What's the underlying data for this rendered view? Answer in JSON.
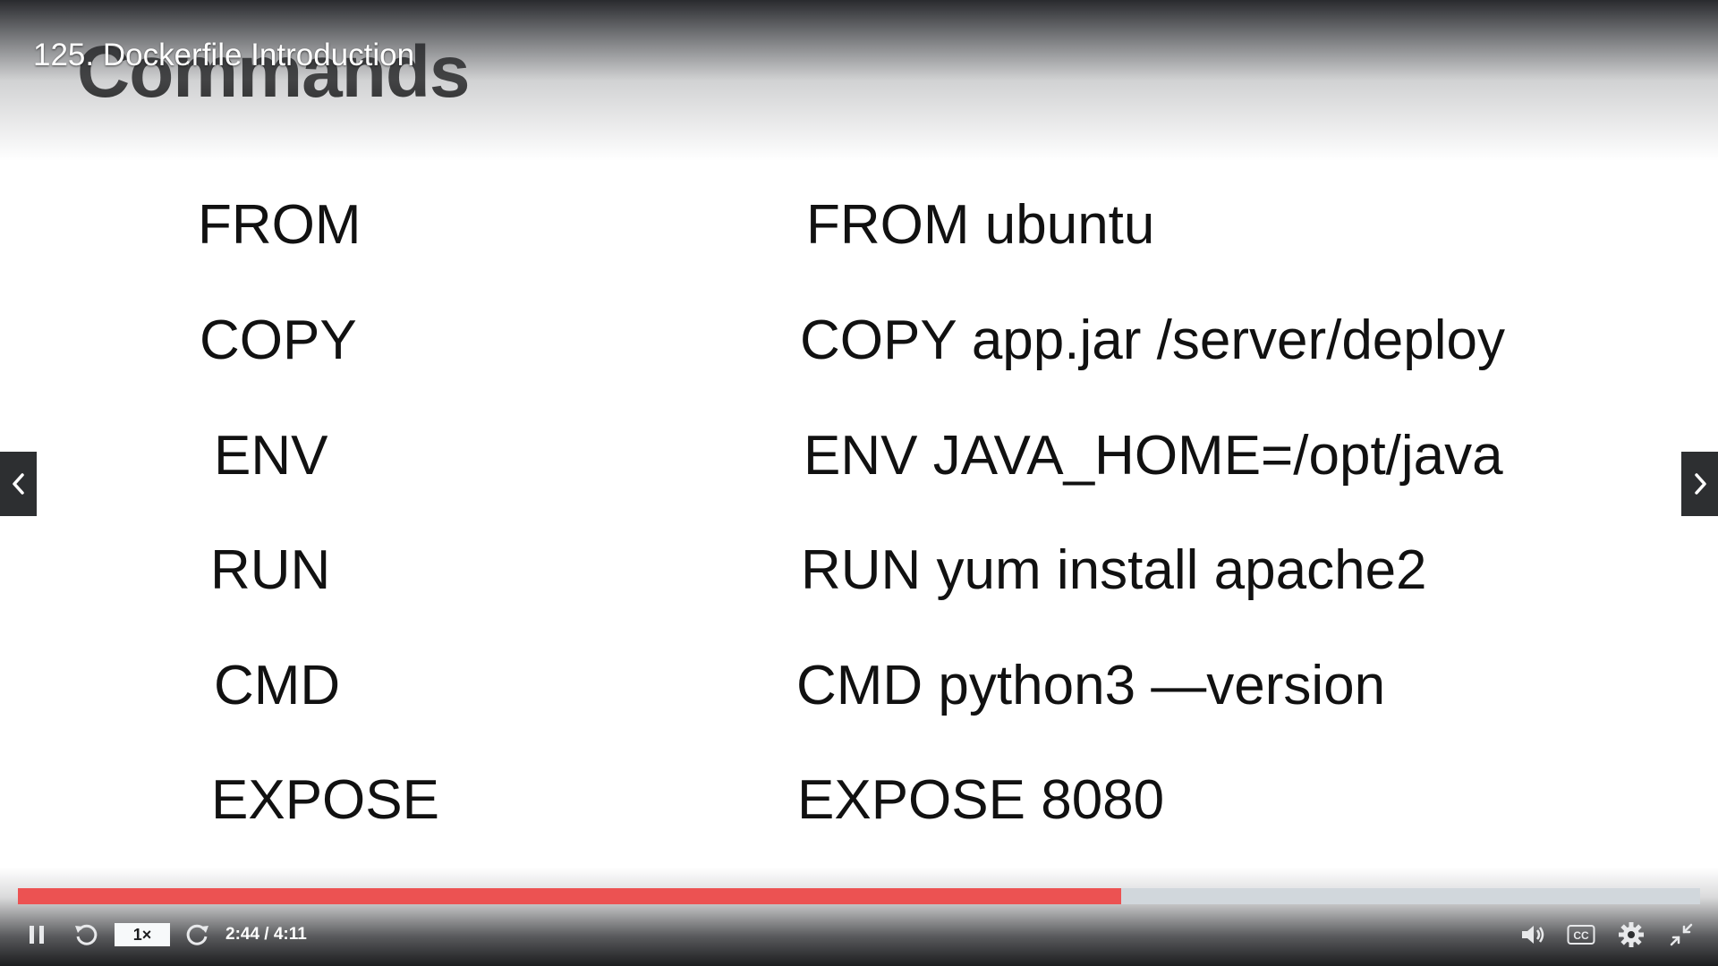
{
  "player": {
    "lecture_title": "125. Dockerfile Introduction",
    "progress_fraction": 0.656,
    "accent_color": "#ec5252",
    "track_color": "#d1d7dc"
  },
  "slide": {
    "heading": "Commands",
    "rows": [
      {
        "keyword": "FROM",
        "example": "FROM ubuntu"
      },
      {
        "keyword": "COPY",
        "example": "COPY app.jar /server/deploy"
      },
      {
        "keyword": "ENV",
        "example": "ENV JAVA_HOME=/opt/java"
      },
      {
        "keyword": "RUN",
        "example": "RUN yum install apache2"
      },
      {
        "keyword": "CMD",
        "example": "CMD python3 —version"
      },
      {
        "keyword": "EXPOSE",
        "example": "EXPOSE 8080"
      }
    ]
  },
  "controls": {
    "play_state_icon": "pause-icon",
    "rewind_icon": "rewind-icon",
    "speed_label": "1×",
    "forward_icon": "forward-icon",
    "time_text": "2:44 / 4:11",
    "volume_icon": "volume-icon",
    "captions_label": "CC",
    "settings_icon": "gear-icon",
    "fullscreen_icon": "exit-fullscreen-icon"
  }
}
